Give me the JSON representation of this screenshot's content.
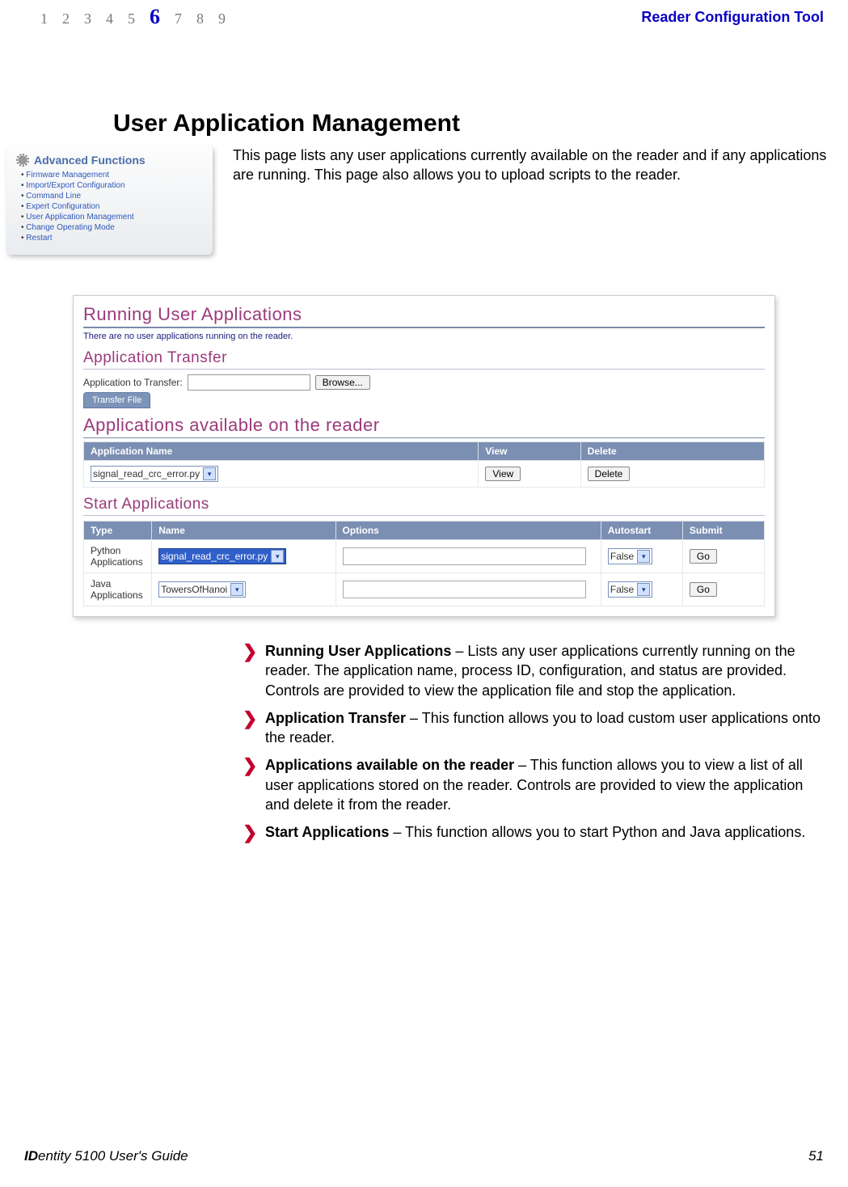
{
  "chapters": [
    "1",
    "2",
    "3",
    "4",
    "5",
    "6",
    "7",
    "8",
    "9"
  ],
  "active_chapter_index": 5,
  "top_right_title": "Reader Configuration Tool",
  "heading": "User Application Management",
  "intro": "This page lists any user applications currently available on the reader and if any applications are running. This page also allows you to upload scripts to the reader.",
  "sidebar": {
    "title": "Advanced Functions",
    "items": [
      "Firmware Management",
      "Import/Export Configuration",
      "Command Line",
      "Expert Configuration",
      "User Application Management",
      "Change Operating Mode",
      "Restart"
    ]
  },
  "panel": {
    "running_title": "Running User Applications",
    "running_msg": "There are no user applications running on the reader.",
    "transfer_title": "Application Transfer",
    "transfer_label": "Application to Transfer:",
    "browse_label": "Browse...",
    "transfer_btn": "Transfer File",
    "available_title": "Applications available on the reader",
    "available_headers": {
      "name": "Application Name",
      "view": "View",
      "delete": "Delete"
    },
    "available_row": {
      "name": "signal_read_crc_error.py",
      "view": "View",
      "delete": "Delete"
    },
    "start_title": "Start Applications",
    "start_headers": {
      "type": "Type",
      "name": "Name",
      "options": "Options",
      "autostart": "Autostart",
      "submit": "Submit"
    },
    "start_rows": [
      {
        "type": "Python Applications",
        "name": "signal_read_crc_error.py",
        "options": "",
        "autostart": "False",
        "submit": "Go"
      },
      {
        "type": "Java Applications",
        "name": "TowersOfHanoi",
        "options": "",
        "autostart": "False",
        "submit": "Go"
      }
    ]
  },
  "bullets": [
    {
      "title": "Running User Applications",
      "body": " – Lists any user applications currently running on the reader. The application name, process ID, configuration, and status are provided. Controls are provided to view the application file and stop the application."
    },
    {
      "title": "Application Transfer",
      "body": " – This function allows you to load custom user applications onto the reader."
    },
    {
      "title": "Applications available on the reader",
      "body": " – This function allows you to view a list of all user applications stored on the reader. Controls are provided to view the application and delete it from the reader."
    },
    {
      "title": "Start Applications",
      "body": " – This function allows you to start Python and Java applications."
    }
  ],
  "footer": {
    "left_prefix": "ID",
    "left_mid": "entity",
    "left_rest": " 5100 User's Guide",
    "page": "51"
  }
}
